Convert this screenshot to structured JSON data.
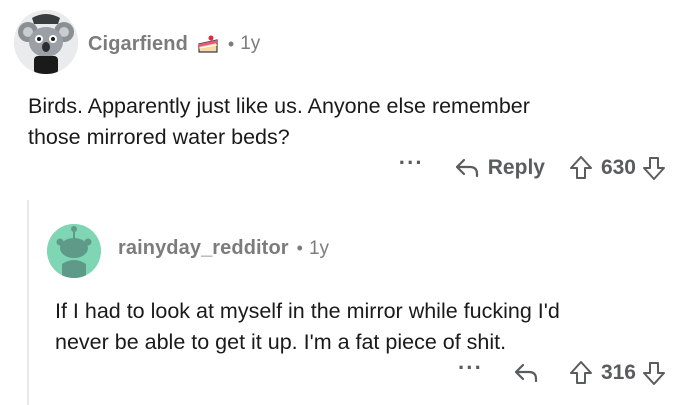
{
  "comments": [
    {
      "username": "Cigarfiend",
      "age": "1y",
      "body_lines": [
        "Birds. Apparently just like us. Anyone else remember",
        "those mirrored water beds?"
      ],
      "more": "···",
      "reply_label": "Reply",
      "score": "630",
      "icons": {
        "avatar": "koala-avatar-icon",
        "flair": "cake-flair-icon",
        "reply": "reply-arrow-icon",
        "upvote": "upvote-arrow-icon",
        "downvote": "downvote-arrow-icon"
      }
    },
    {
      "username": "rainyday_redditor",
      "age": "1y",
      "body_lines": [
        "If I had to look at myself in the mirror while fucking I'd",
        "never be able to get it up. I'm a fat piece of shit."
      ],
      "more": "···",
      "score": "316",
      "icons": {
        "avatar": "snoo-avatar-icon",
        "reply": "reply-arrow-icon",
        "upvote": "upvote-arrow-icon",
        "downvote": "downvote-arrow-icon"
      }
    }
  ],
  "colors": {
    "text": "#1a1a1b",
    "meta": "#7c7c7c",
    "action": "#5a5c5e",
    "avatar2_bg": "#7fd6b4",
    "thread_line": "#e6e8ea"
  }
}
